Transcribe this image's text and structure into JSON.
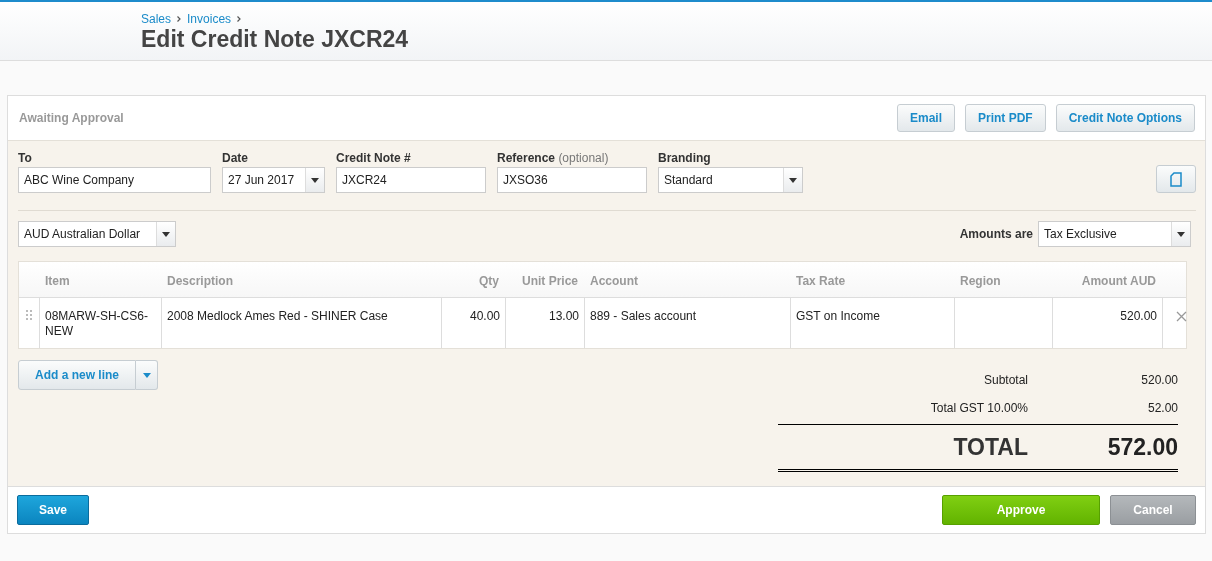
{
  "breadcrumbs": [
    "Sales",
    "Invoices"
  ],
  "title": "Edit Credit Note JXCR24",
  "status": "Awaiting Approval",
  "actions": [
    "Email",
    "Print PDF",
    "Credit Note Options"
  ],
  "fields": [
    {
      "label": "To",
      "value": "ABC Wine Company",
      "kind": "text"
    },
    {
      "label": "Date",
      "value": "27 Jun 2017",
      "kind": "select"
    },
    {
      "label": "Credit Note #",
      "value": "JXCR24",
      "kind": "text"
    },
    {
      "label": "Reference",
      "hint": "(optional)",
      "value": "JXSO36",
      "kind": "text"
    },
    {
      "label": "Branding",
      "value": "Standard",
      "kind": "select"
    }
  ],
  "currency": "AUD Australian Dollar",
  "amounts_label": "Amounts are",
  "amounts_value": "Tax Exclusive",
  "table": {
    "columns": [
      "Item",
      "Description",
      "Qty",
      "Unit Price",
      "Account",
      "Tax Rate",
      "Region",
      "Amount AUD"
    ],
    "rows": [
      [
        "08MARW-SH-CS6-NEW",
        "2008 Medlock Ames Red - SHINER Case",
        "40.00",
        "13.00",
        "889 - Sales account",
        "GST on Income",
        "",
        "520.00"
      ]
    ]
  },
  "add_line": "Add a new line",
  "totals": [
    {
      "label": "Subtotal",
      "value": "520.00"
    },
    {
      "label": "Total GST 10.00%",
      "value": "52.00"
    }
  ],
  "total": {
    "label": "TOTAL",
    "value": "572.00"
  },
  "footer": {
    "save": "Save",
    "approve": "Approve",
    "cancel": "Cancel"
  }
}
